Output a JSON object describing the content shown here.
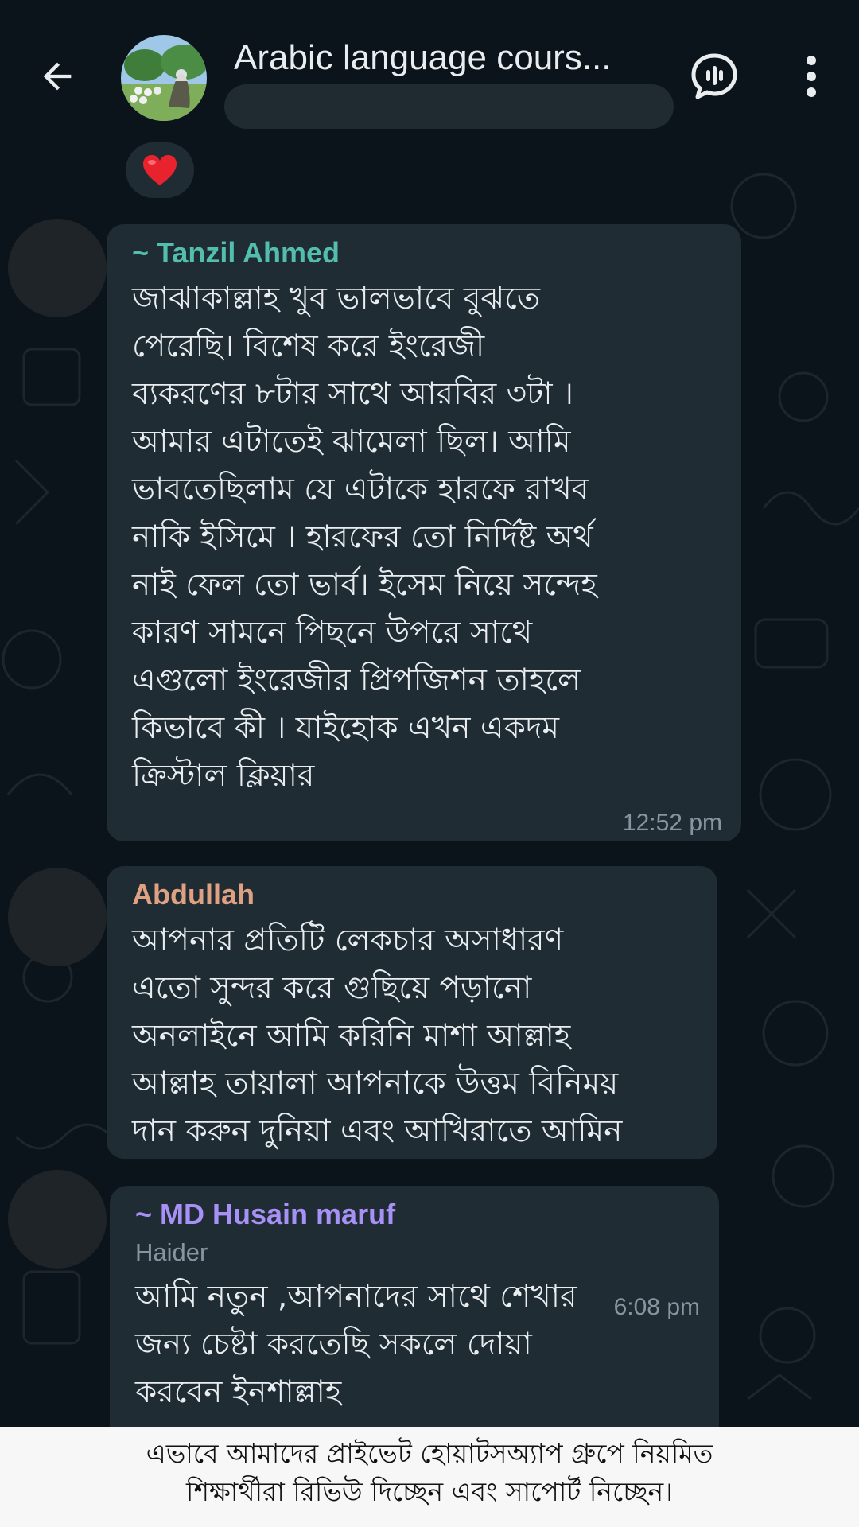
{
  "header": {
    "title": "Arabic language cours...",
    "back_icon": "arrow-left-icon",
    "call_icon": "voice-chat-icon",
    "menu_icon": "more-vertical-icon"
  },
  "reaction": {
    "emoji": "❤️"
  },
  "messages": [
    {
      "sender": "~ Tanzil Ahmed",
      "sender_color": "#53bdae",
      "text": "জাঝাকাল্লাহ খুব ভালভাবে বুঝতে\nপেরেছি। বিশেষ করে ইংরেজী\nব্যকরণের ৮টার সাথে আরবির ৩টা ।\nআমার এটাতেই ঝামেলা ছিল। আমি\nভাবতেছিলাম যে এটাকে হারফে রাখব\nনাকি ইসিমে । হারফের তো নির্দিষ্ট অর্থ\nনাই ফেল তো ভার্ব। ইসেম নিয়ে সন্দেহ\nকারণ সামনে পিছনে উপরে সাথে\nএগুলো ইংরেজীর প্রিপজিশন তাহলে\nকিভাবে কী । যাইহোক এখন একদম\nক্রিস্টাল ক্লিয়ার",
      "time": "12:52 pm"
    },
    {
      "sender": "Abdullah",
      "sender_color": "#dfa182",
      "text": "আপনার প্রতিটি লেকচার অসাধারণ\nএতো সুন্দর করে গুছিয়ে পড়ানো\nঅনলাইনে আমি করিনি মাশা আল্লাহ\nআল্লাহ তায়ালা আপনাকে উত্তম বিনিময়\nদান করুন দুনিয়া এবং আখিরাতে আমিন"
    },
    {
      "sender": "~ MD Husain maruf",
      "sender_color": "#a791f6",
      "secondary": "Haider",
      "text": "আমি নতুন ,আপনাদের সাথে শেখার\nজন্য চেষ্টা করতেছি সকলে দোয়া\nকরবেন ইনশাল্লাহ",
      "time": "6:08 pm"
    }
  ],
  "caption": {
    "line1": "এভাবে আমাদের প্রাইভেট হোয়াটসঅ্যাপ গ্রুপে নিয়মিত",
    "line2": "শিক্ষার্থীরা রিভিউ দিচ্ছেন এবং সাপোর্ট নিচ্ছেন।"
  },
  "colors": {
    "background": "#0b141a",
    "bubble": "#1f2c34",
    "text": "#e9edef",
    "muted": "#8696a0"
  }
}
